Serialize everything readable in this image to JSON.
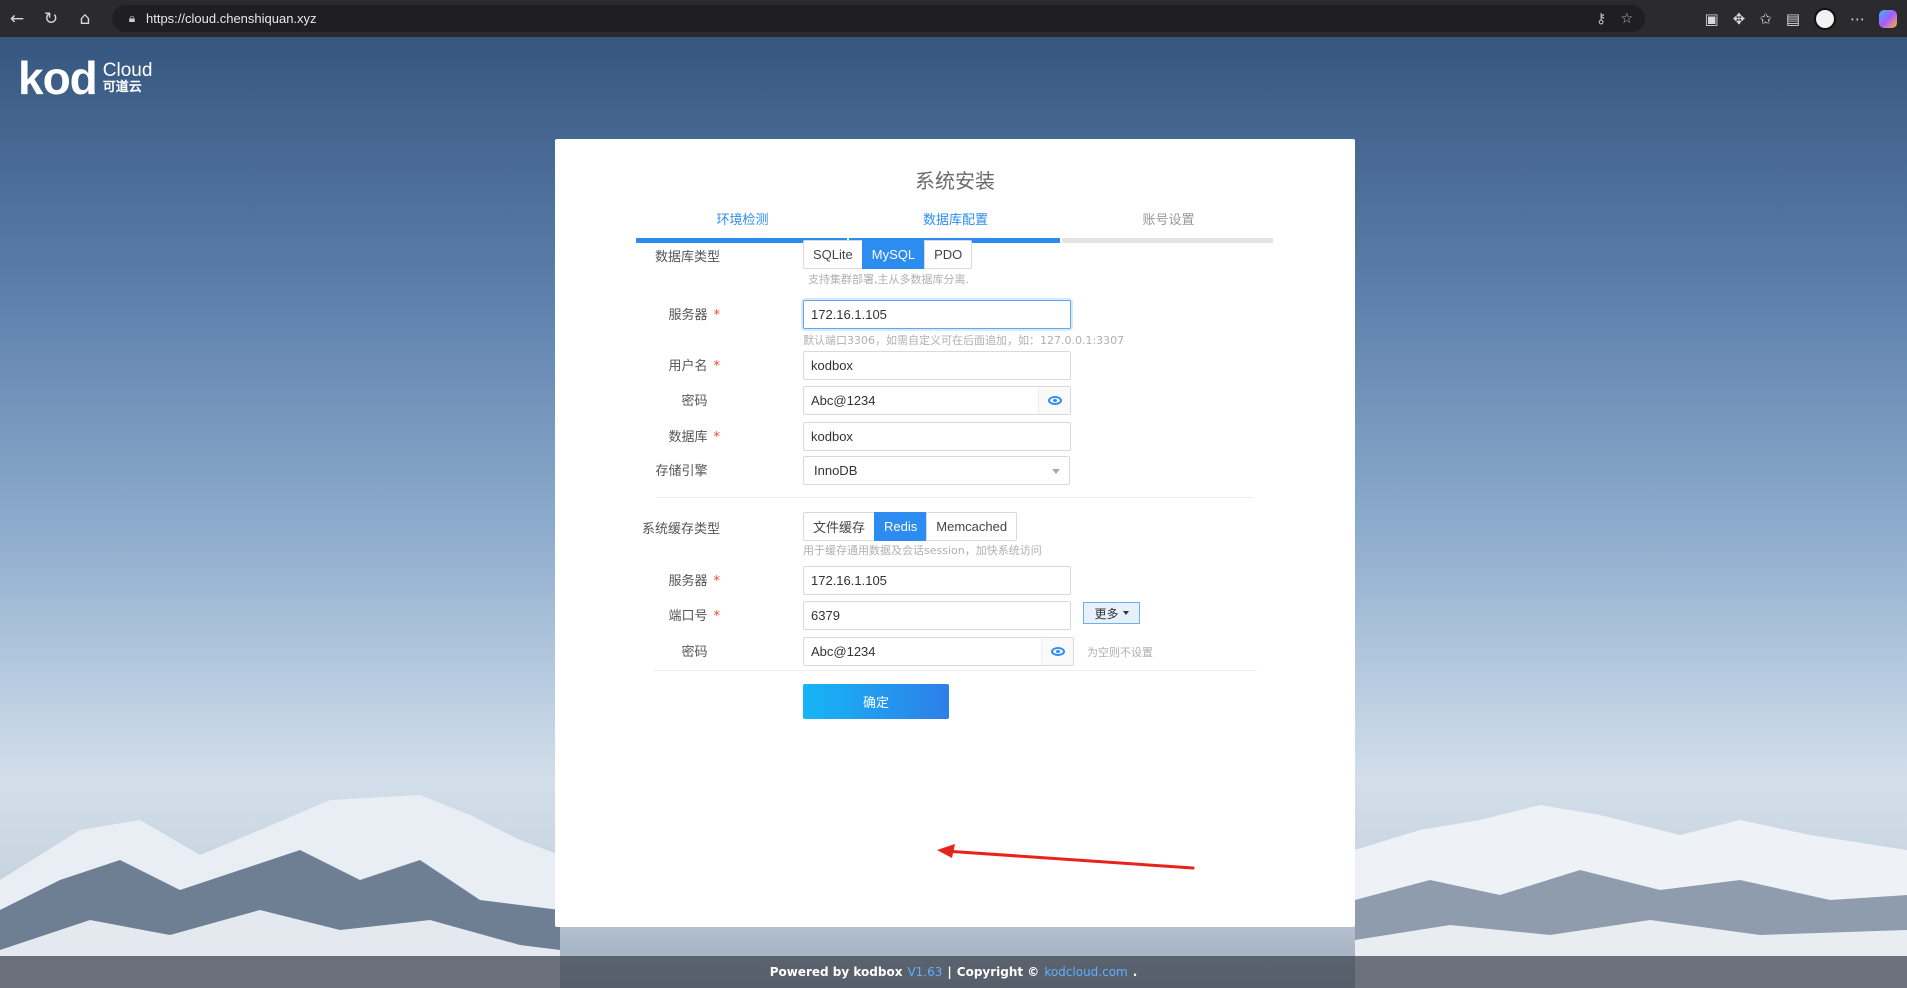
{
  "browser": {
    "url": "https://cloud.chenshiquan.xyz"
  },
  "logo": {
    "main": "kod",
    "en": "Cloud",
    "cn": "可道云"
  },
  "card": {
    "title": "系统安装",
    "steps": [
      "环境检测",
      "数据库配置",
      "账号设置"
    ]
  },
  "db": {
    "type_label": "数据库类型",
    "type_options": [
      "SQLite",
      "MySQL",
      "PDO"
    ],
    "type_selected": "MySQL",
    "type_hint": "支持集群部署,主从多数据库分离.",
    "server_label": "服务器",
    "server_value": "172.16.1.105",
    "server_hint": "默认端口3306，如需自定义可在后面追加，如：127.0.0.1:3307",
    "user_label": "用户名",
    "user_value": "kodbox",
    "password_label": "密码",
    "password_value": "Abc@1234",
    "name_label": "数据库",
    "name_value": "kodbox",
    "engine_label": "存储引擎",
    "engine_value": "InnoDB"
  },
  "cache": {
    "type_label": "系统缓存类型",
    "type_options": [
      "文件缓存",
      "Redis",
      "Memcached"
    ],
    "type_selected": "Redis",
    "type_hint": "用于缓存通用数据及会话session，加快系统访问",
    "server_label": "服务器",
    "server_value": "172.16.1.105",
    "port_label": "端口号",
    "port_value": "6379",
    "more_label": "更多",
    "password_label": "密码",
    "password_value": "Abc@1234",
    "password_hint": "为空则不设置"
  },
  "submit_label": "确定",
  "footer": {
    "powered": "Powered by kodbox",
    "version": "V1.63",
    "sep": "|",
    "copyright": "Copyright ©",
    "site": "kodcloud.com",
    "dot": "."
  },
  "colors": {
    "accent": "#2d8cf0",
    "required": "#e84a3c",
    "arrow": "#e8231c"
  }
}
